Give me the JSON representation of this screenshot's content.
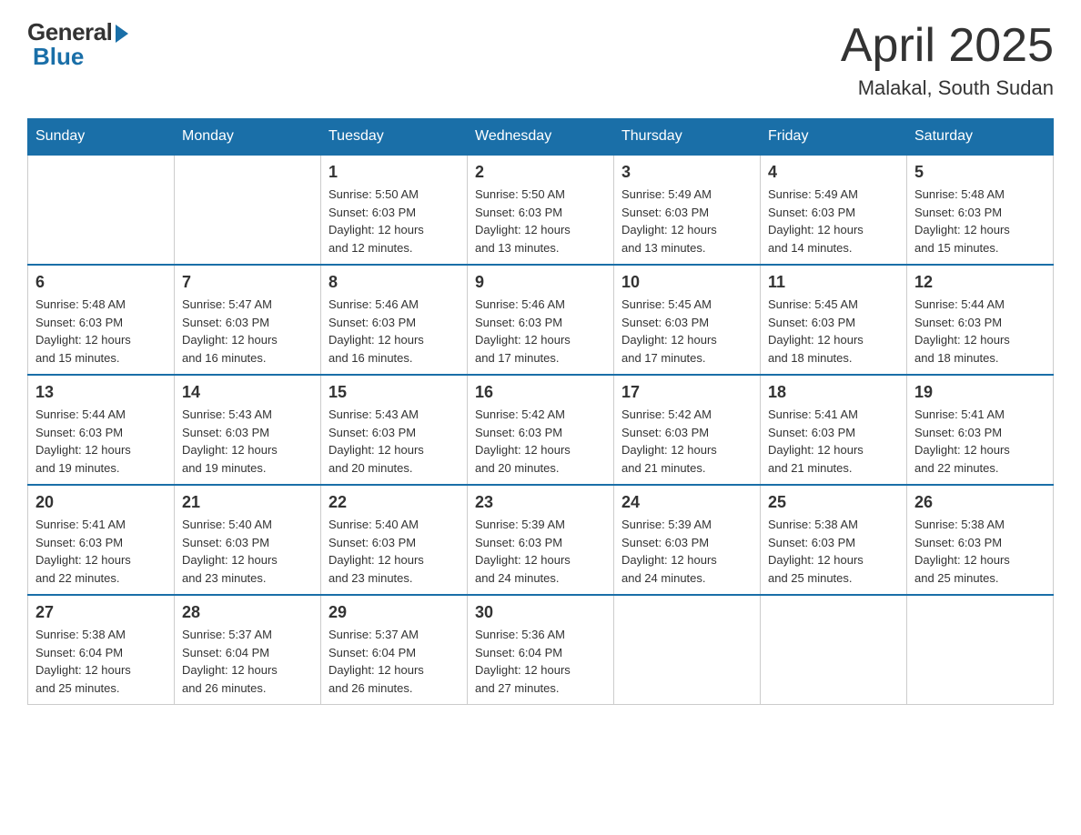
{
  "header": {
    "logo_general": "General",
    "logo_blue": "Blue",
    "title": "April 2025",
    "subtitle": "Malakal, South Sudan"
  },
  "weekdays": [
    "Sunday",
    "Monday",
    "Tuesday",
    "Wednesday",
    "Thursday",
    "Friday",
    "Saturday"
  ],
  "weeks": [
    [
      {
        "day": "",
        "info": ""
      },
      {
        "day": "",
        "info": ""
      },
      {
        "day": "1",
        "info": "Sunrise: 5:50 AM\nSunset: 6:03 PM\nDaylight: 12 hours\nand 12 minutes."
      },
      {
        "day": "2",
        "info": "Sunrise: 5:50 AM\nSunset: 6:03 PM\nDaylight: 12 hours\nand 13 minutes."
      },
      {
        "day": "3",
        "info": "Sunrise: 5:49 AM\nSunset: 6:03 PM\nDaylight: 12 hours\nand 13 minutes."
      },
      {
        "day": "4",
        "info": "Sunrise: 5:49 AM\nSunset: 6:03 PM\nDaylight: 12 hours\nand 14 minutes."
      },
      {
        "day": "5",
        "info": "Sunrise: 5:48 AM\nSunset: 6:03 PM\nDaylight: 12 hours\nand 15 minutes."
      }
    ],
    [
      {
        "day": "6",
        "info": "Sunrise: 5:48 AM\nSunset: 6:03 PM\nDaylight: 12 hours\nand 15 minutes."
      },
      {
        "day": "7",
        "info": "Sunrise: 5:47 AM\nSunset: 6:03 PM\nDaylight: 12 hours\nand 16 minutes."
      },
      {
        "day": "8",
        "info": "Sunrise: 5:46 AM\nSunset: 6:03 PM\nDaylight: 12 hours\nand 16 minutes."
      },
      {
        "day": "9",
        "info": "Sunrise: 5:46 AM\nSunset: 6:03 PM\nDaylight: 12 hours\nand 17 minutes."
      },
      {
        "day": "10",
        "info": "Sunrise: 5:45 AM\nSunset: 6:03 PM\nDaylight: 12 hours\nand 17 minutes."
      },
      {
        "day": "11",
        "info": "Sunrise: 5:45 AM\nSunset: 6:03 PM\nDaylight: 12 hours\nand 18 minutes."
      },
      {
        "day": "12",
        "info": "Sunrise: 5:44 AM\nSunset: 6:03 PM\nDaylight: 12 hours\nand 18 minutes."
      }
    ],
    [
      {
        "day": "13",
        "info": "Sunrise: 5:44 AM\nSunset: 6:03 PM\nDaylight: 12 hours\nand 19 minutes."
      },
      {
        "day": "14",
        "info": "Sunrise: 5:43 AM\nSunset: 6:03 PM\nDaylight: 12 hours\nand 19 minutes."
      },
      {
        "day": "15",
        "info": "Sunrise: 5:43 AM\nSunset: 6:03 PM\nDaylight: 12 hours\nand 20 minutes."
      },
      {
        "day": "16",
        "info": "Sunrise: 5:42 AM\nSunset: 6:03 PM\nDaylight: 12 hours\nand 20 minutes."
      },
      {
        "day": "17",
        "info": "Sunrise: 5:42 AM\nSunset: 6:03 PM\nDaylight: 12 hours\nand 21 minutes."
      },
      {
        "day": "18",
        "info": "Sunrise: 5:41 AM\nSunset: 6:03 PM\nDaylight: 12 hours\nand 21 minutes."
      },
      {
        "day": "19",
        "info": "Sunrise: 5:41 AM\nSunset: 6:03 PM\nDaylight: 12 hours\nand 22 minutes."
      }
    ],
    [
      {
        "day": "20",
        "info": "Sunrise: 5:41 AM\nSunset: 6:03 PM\nDaylight: 12 hours\nand 22 minutes."
      },
      {
        "day": "21",
        "info": "Sunrise: 5:40 AM\nSunset: 6:03 PM\nDaylight: 12 hours\nand 23 minutes."
      },
      {
        "day": "22",
        "info": "Sunrise: 5:40 AM\nSunset: 6:03 PM\nDaylight: 12 hours\nand 23 minutes."
      },
      {
        "day": "23",
        "info": "Sunrise: 5:39 AM\nSunset: 6:03 PM\nDaylight: 12 hours\nand 24 minutes."
      },
      {
        "day": "24",
        "info": "Sunrise: 5:39 AM\nSunset: 6:03 PM\nDaylight: 12 hours\nand 24 minutes."
      },
      {
        "day": "25",
        "info": "Sunrise: 5:38 AM\nSunset: 6:03 PM\nDaylight: 12 hours\nand 25 minutes."
      },
      {
        "day": "26",
        "info": "Sunrise: 5:38 AM\nSunset: 6:03 PM\nDaylight: 12 hours\nand 25 minutes."
      }
    ],
    [
      {
        "day": "27",
        "info": "Sunrise: 5:38 AM\nSunset: 6:04 PM\nDaylight: 12 hours\nand 25 minutes."
      },
      {
        "day": "28",
        "info": "Sunrise: 5:37 AM\nSunset: 6:04 PM\nDaylight: 12 hours\nand 26 minutes."
      },
      {
        "day": "29",
        "info": "Sunrise: 5:37 AM\nSunset: 6:04 PM\nDaylight: 12 hours\nand 26 minutes."
      },
      {
        "day": "30",
        "info": "Sunrise: 5:36 AM\nSunset: 6:04 PM\nDaylight: 12 hours\nand 27 minutes."
      },
      {
        "day": "",
        "info": ""
      },
      {
        "day": "",
        "info": ""
      },
      {
        "day": "",
        "info": ""
      }
    ]
  ]
}
